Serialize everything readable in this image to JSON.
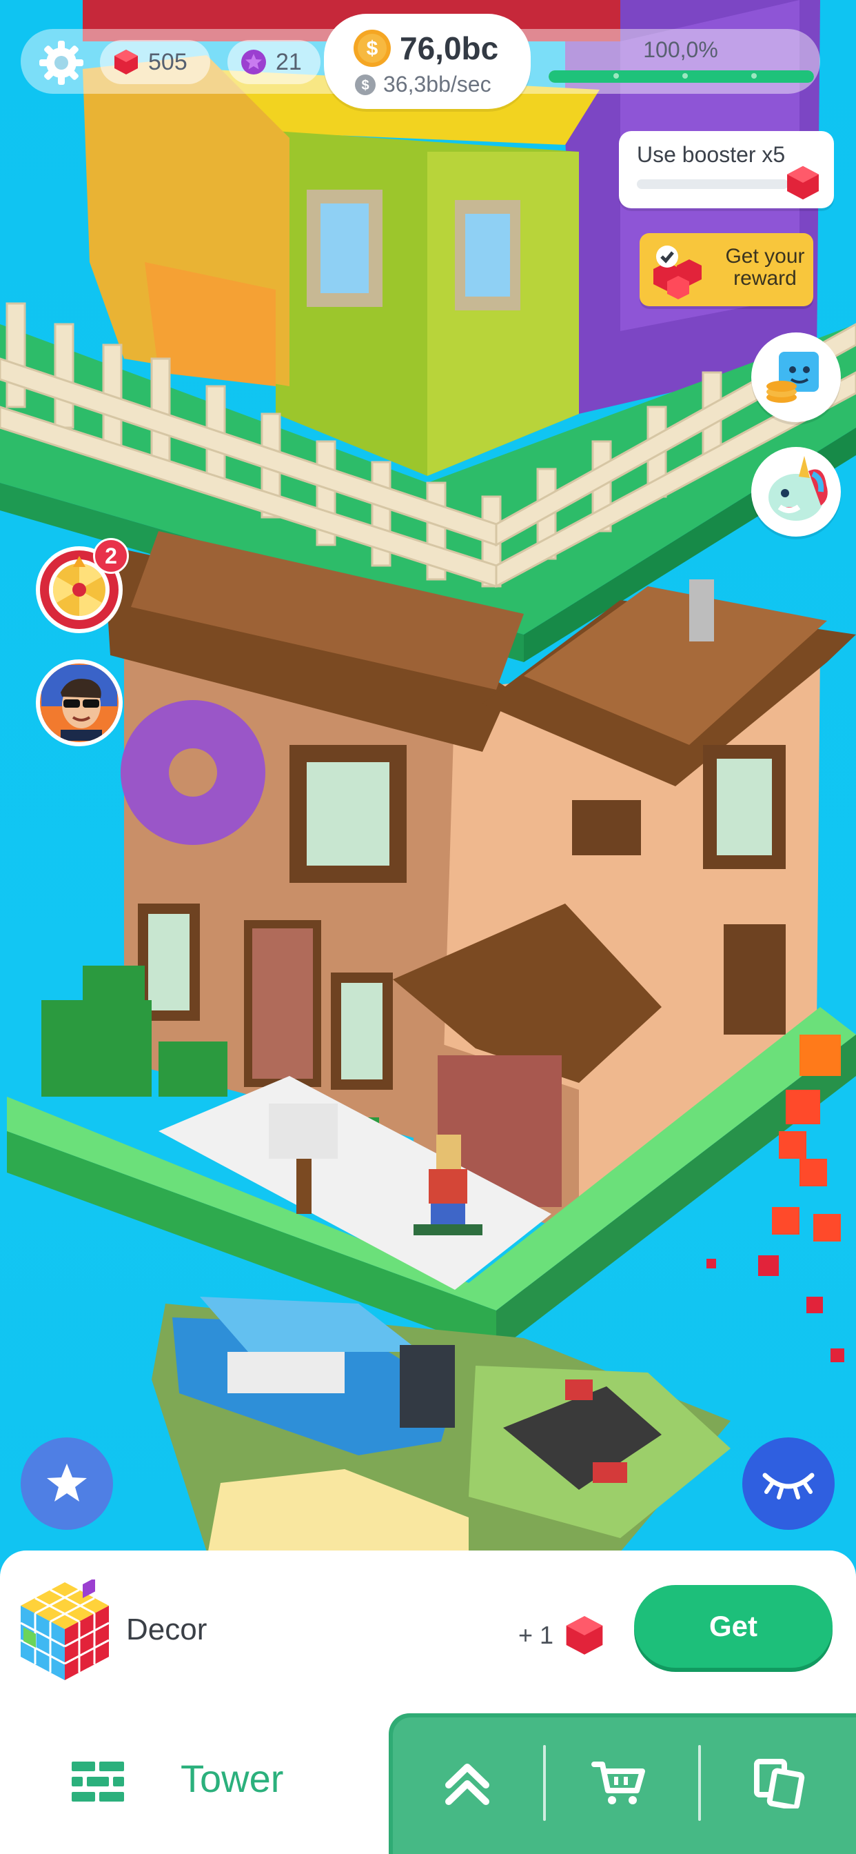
{
  "hud": {
    "settings_icon": "gear-icon",
    "gems": "505",
    "tokens": "21",
    "coins": "76,0bc",
    "coin_rate": "36,3bb/sec",
    "progress_label": "100,0%",
    "progress_value": 1.0
  },
  "right_panel": {
    "booster_label": "Use booster x5",
    "reward_label": "Get your reward"
  },
  "left_panel": {
    "wheel_badge": "2"
  },
  "bottom": {
    "item_name": "Decor",
    "reward_text": "+ 1",
    "get_label": "Get",
    "tab_label": "Tower"
  },
  "colors": {
    "sky": "#10c3f1",
    "accent_green": "#1dbf7a",
    "gem_red": "#e2233a",
    "token_purple": "#9b3fd0",
    "coin_gold": "#f5a623"
  }
}
